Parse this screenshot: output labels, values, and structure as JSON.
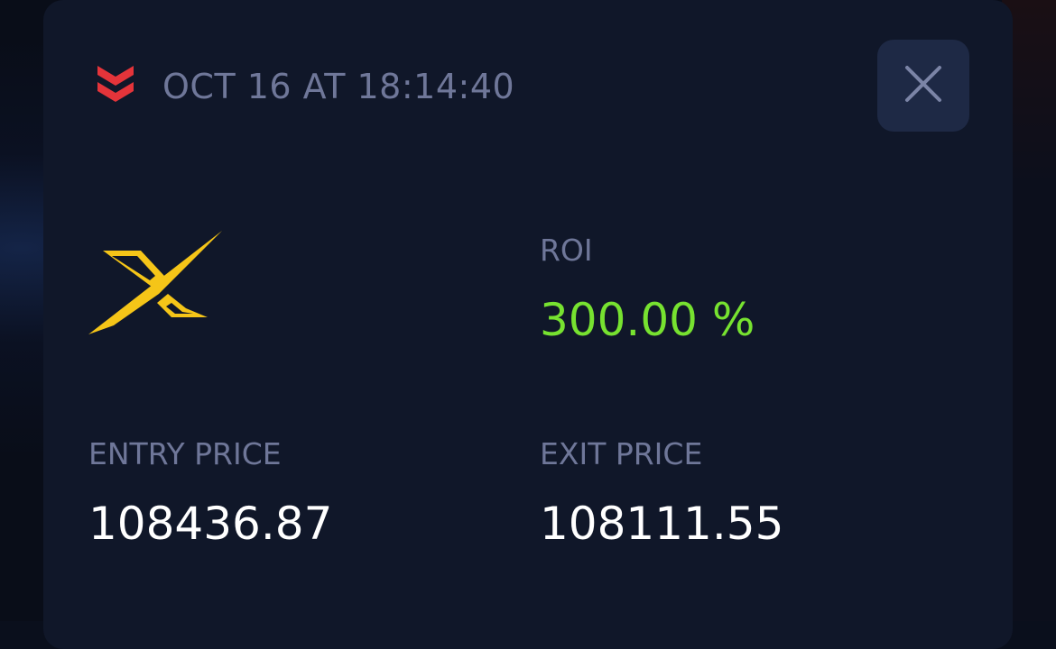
{
  "trade": {
    "timestamp": "OCT 16 AT 18:14:40",
    "direction_icon": "double-chevron-down-icon",
    "direction_color": "#e4343a"
  },
  "close_button": {
    "icon": "close-icon"
  },
  "logo": {
    "icon": "x-brand-logo",
    "color": "#f5c518"
  },
  "roi": {
    "label": "ROI",
    "value": "300.00 %",
    "color": "#77e230"
  },
  "entry": {
    "label": "ENTRY PRICE",
    "value": "108436.87"
  },
  "exit": {
    "label": "EXIT PRICE",
    "value": "108111.55"
  }
}
